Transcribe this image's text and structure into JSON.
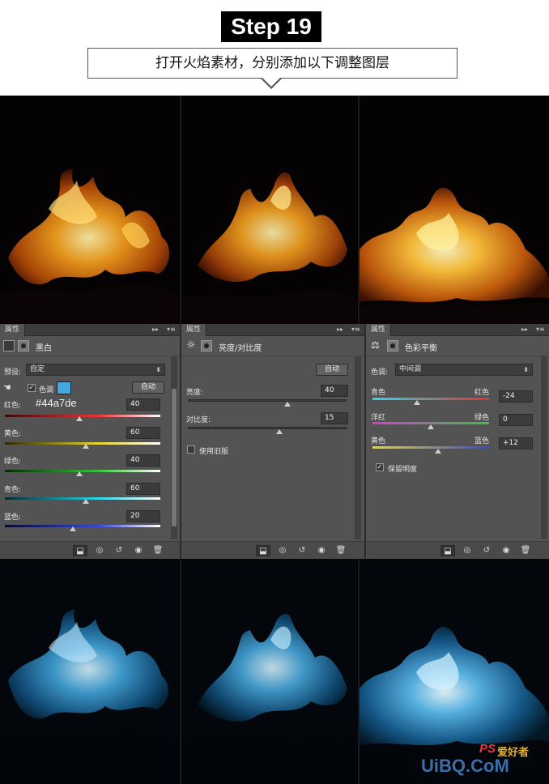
{
  "header": {
    "step_label": "Step 19",
    "caption": "打开火焰素材，分别添加以下调整图层"
  },
  "colors": {
    "fire_orange": "#f6a11e",
    "fire_blue": "#44a7de",
    "panel_bg": "#535353"
  },
  "panel_black_white": {
    "tab": "属性",
    "title": "黑白",
    "preset_label": "预设:",
    "preset_value": "自定",
    "tint_label": "色调",
    "tint_checked": true,
    "tint_color": "#44a7de",
    "hex_annotation": "#44a7de",
    "auto_button": "自动",
    "sliders": [
      {
        "label": "红色:",
        "value": "40"
      },
      {
        "label": "黄色:",
        "value": "60"
      },
      {
        "label": "绿色:",
        "value": "40"
      },
      {
        "label": "青色:",
        "value": "60"
      },
      {
        "label": "蓝色:",
        "value": "20"
      }
    ]
  },
  "panel_brightness": {
    "tab": "属性",
    "title": "亮度/对比度",
    "auto_button": "自动",
    "brightness_label": "亮度:",
    "brightness_value": "40",
    "contrast_label": "对比度:",
    "contrast_value": "15",
    "legacy_label": "使用旧版",
    "legacy_checked": false
  },
  "panel_color_balance": {
    "tab": "属性",
    "title": "色彩平衡",
    "tone_label": "色调:",
    "tone_value": "中间调",
    "sliders": [
      {
        "left": "青色",
        "right": "红色",
        "value": "-24"
      },
      {
        "left": "洋红",
        "right": "绿色",
        "value": "0"
      },
      {
        "left": "黄色",
        "right": "蓝色",
        "value": "+12"
      }
    ],
    "preserve_label": "保留明度",
    "preserve_checked": true
  },
  "watermark": {
    "site": "UiBQ.CoM",
    "ps_text": "PS",
    "cn_text": "爱好者"
  }
}
